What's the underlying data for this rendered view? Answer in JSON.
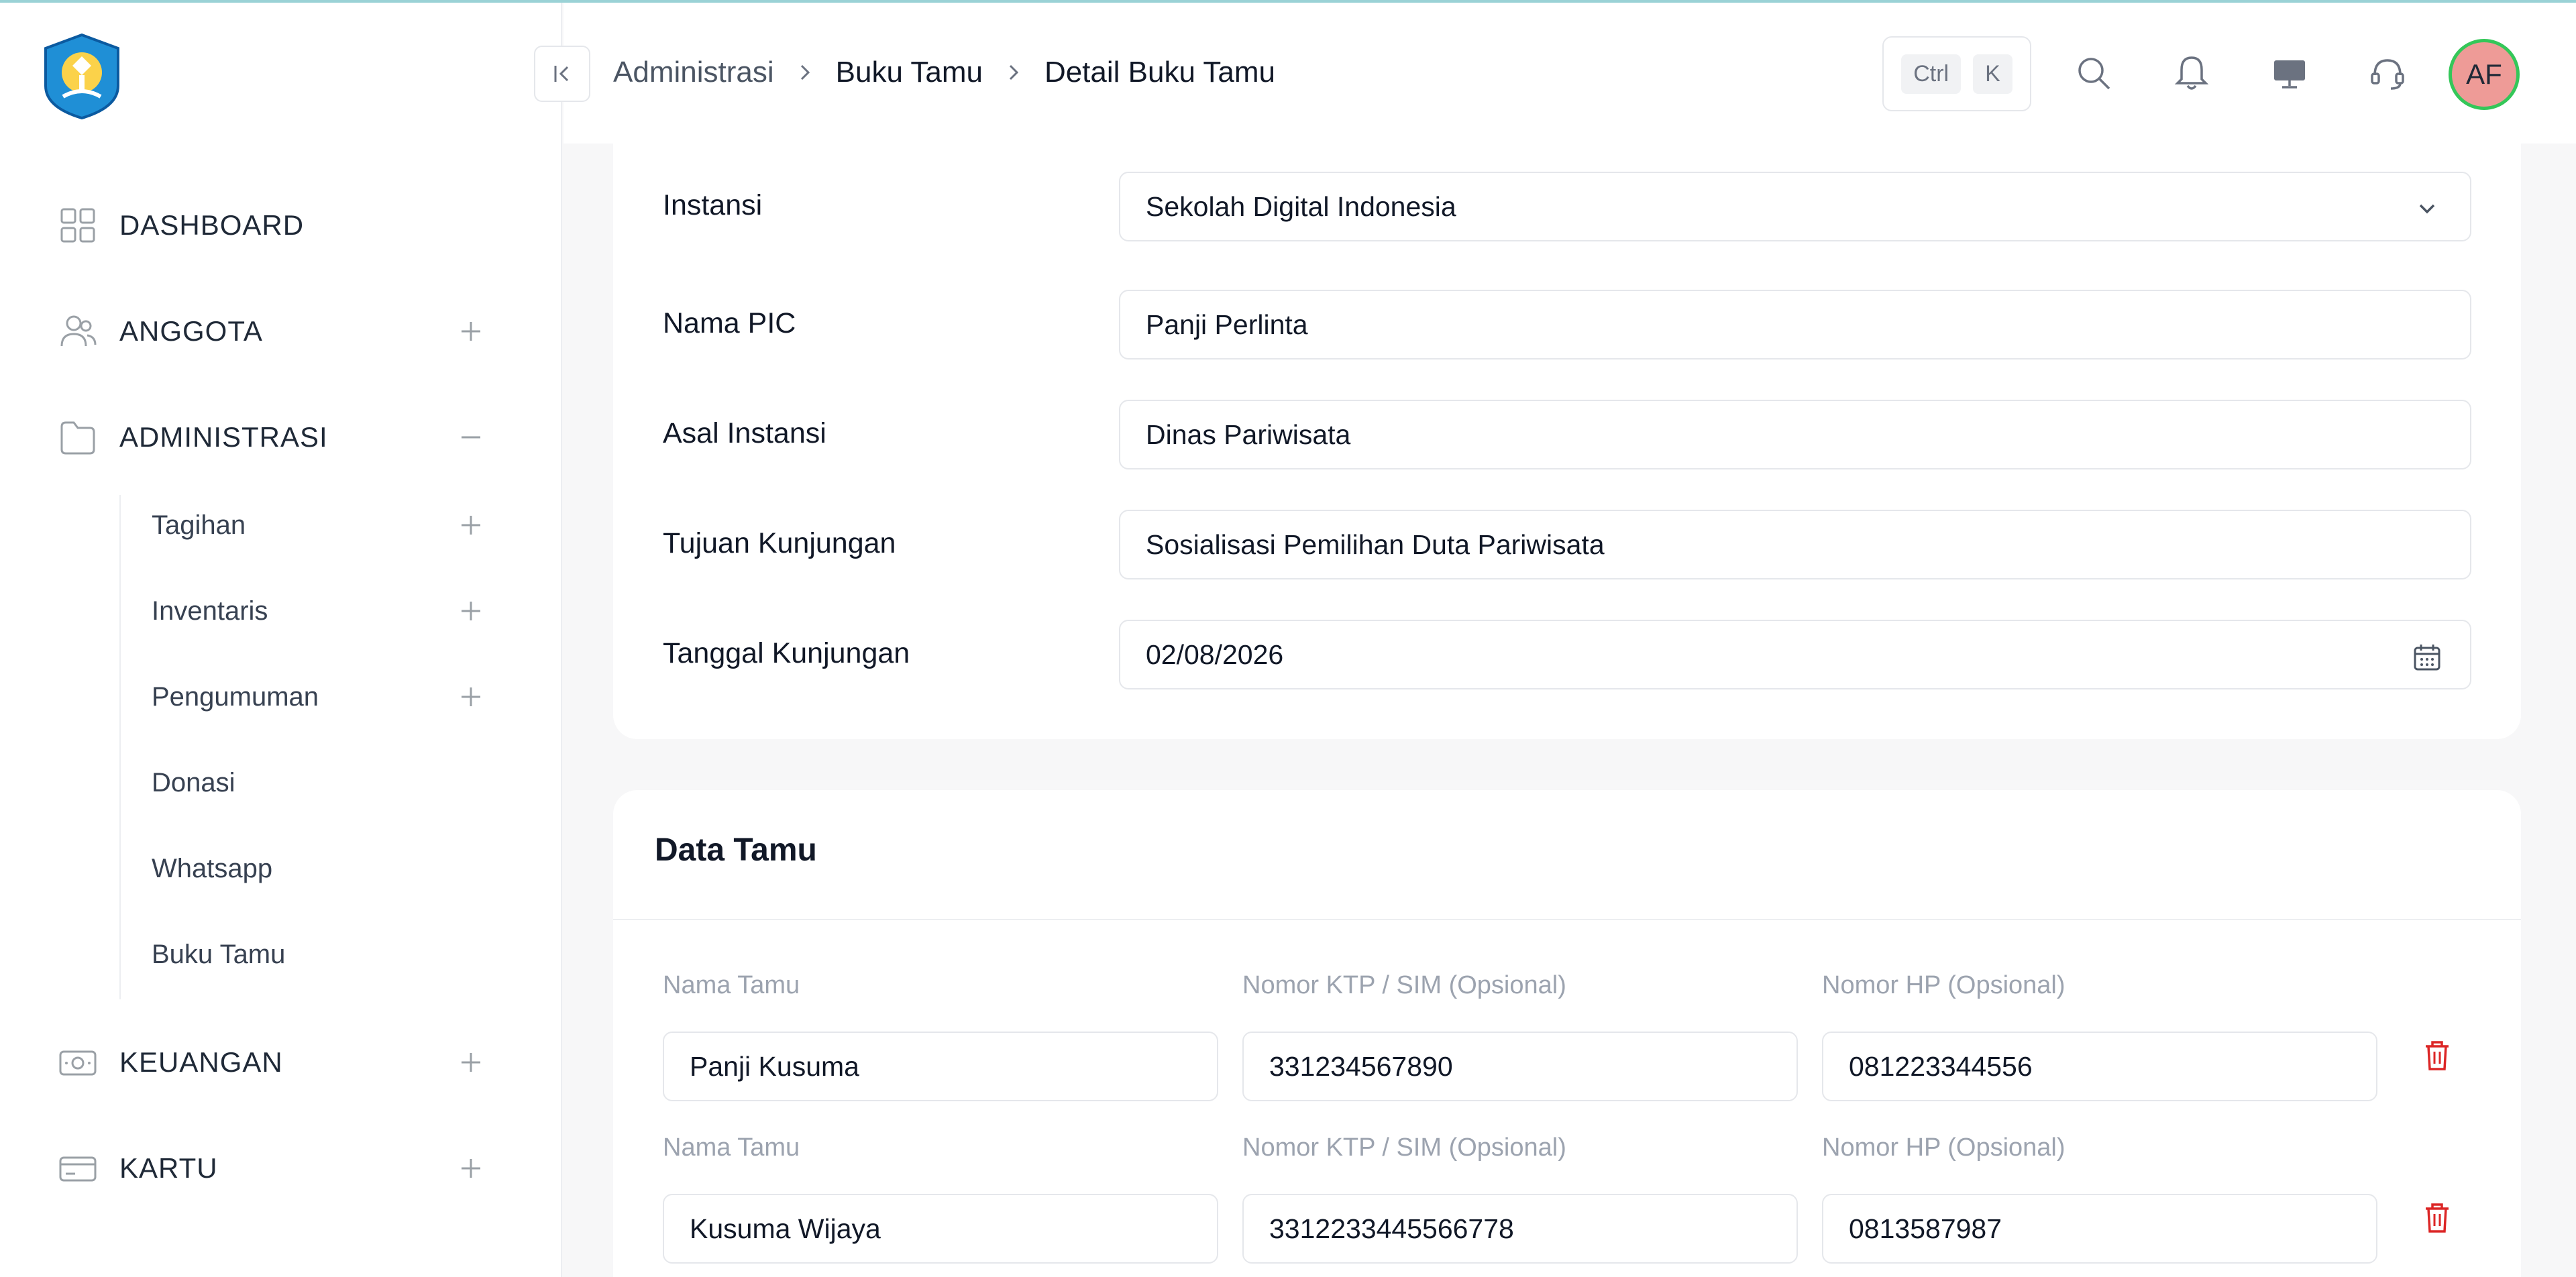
{
  "sidebar": {
    "items": [
      {
        "label": "DASHBOARD",
        "icon": "dashboard-grid-icon"
      },
      {
        "label": "ANGGOTA",
        "icon": "users-icon"
      },
      {
        "label": "ADMINISTRASI",
        "icon": "folder-icon"
      },
      {
        "label": "KEUANGAN",
        "icon": "cash-icon"
      },
      {
        "label": "KARTU",
        "icon": "card-icon"
      }
    ],
    "sub_items": [
      "Tagihan",
      "Inventaris",
      "Pengumuman",
      "Donasi",
      "Whatsapp",
      "Buku Tamu"
    ]
  },
  "header": {
    "breadcrumb": [
      "Administrasi",
      "Buku Tamu",
      "Detail Buku Tamu"
    ],
    "shortcut": [
      "Ctrl",
      "K"
    ],
    "avatar_initials": "AF"
  },
  "form": {
    "instansi": {
      "label": "Instansi",
      "value": "Sekolah Digital Indonesia"
    },
    "nama_pic": {
      "label": "Nama PIC",
      "value": "Panji Perlinta"
    },
    "asal_instansi": {
      "label": "Asal Instansi",
      "value": "Dinas Pariwisata"
    },
    "tujuan": {
      "label": "Tujuan Kunjungan",
      "value": "Sosialisasi Pemilihan Duta Pariwisata"
    },
    "tanggal": {
      "label": "Tanggal Kunjungan",
      "value": "02/08/2026"
    }
  },
  "data_tamu": {
    "title": "Data Tamu",
    "labels": {
      "nama": "Nama Tamu",
      "ktp": "Nomor KTP / SIM (Opsional)",
      "hp": "Nomor HP (Opsional)"
    },
    "guests": [
      {
        "nama": "Panji Kusuma",
        "ktp": "331234567890",
        "hp": "081223344556"
      },
      {
        "nama": "Kusuma Wijaya",
        "ktp": "3312233445566778",
        "hp": "0813587987"
      }
    ]
  },
  "colors": {
    "accent_delete": "#dc2626",
    "avatar_bg": "#ee9b97",
    "avatar_ring": "#34c759"
  }
}
